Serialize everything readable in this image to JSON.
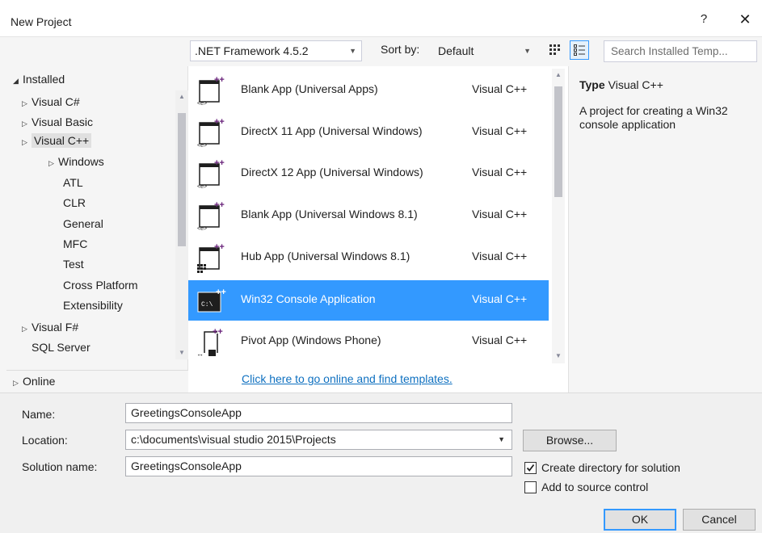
{
  "window": {
    "title": "New Project",
    "help_label": "?",
    "close_label": "✕"
  },
  "toolbar": {
    "framework": ".NET Framework 4.5.2",
    "sort_label": "Sort by:",
    "sort_value": "Default",
    "search_placeholder": "Search Installed Temp..."
  },
  "tree": {
    "installed": "Installed",
    "items": [
      "Visual C#",
      "Visual Basic",
      "Visual C++",
      "Windows",
      "ATL",
      "CLR",
      "General",
      "MFC",
      "Test",
      "Cross Platform",
      "Extensibility",
      "Visual F#",
      "SQL Server"
    ],
    "online": "Online"
  },
  "templates": [
    {
      "name": "Blank App (Universal Apps)",
      "lang": "Visual C++"
    },
    {
      "name": "DirectX 11 App (Universal Windows)",
      "lang": "Visual C++"
    },
    {
      "name": "DirectX 12 App (Universal Windows)",
      "lang": "Visual C++"
    },
    {
      "name": "Blank App (Universal Windows 8.1)",
      "lang": "Visual C++"
    },
    {
      "name": "Hub App (Universal Windows 8.1)",
      "lang": "Visual C++"
    },
    {
      "name": "Win32 Console Application",
      "lang": "Visual C++"
    },
    {
      "name": "Pivot App (Windows Phone)",
      "lang": "Visual C++"
    }
  ],
  "online_link": "Click here to go online and find templates.",
  "details": {
    "type_label": "Type",
    "type_value": "Visual C++",
    "description": "A project for creating a Win32 console application"
  },
  "form": {
    "name_label": "Name:",
    "name_value": "GreetingsConsoleApp",
    "location_label": "Location:",
    "location_value": "c:\\documents\\visual studio 2015\\Projects",
    "solution_label": "Solution name:",
    "solution_value": "GreetingsConsoleApp",
    "browse_label": "Browse...",
    "create_dir_label": "Create directory for solution",
    "create_dir_checked": true,
    "source_control_label": "Add to source control",
    "source_control_checked": false,
    "ok_label": "OK",
    "cancel_label": "Cancel"
  },
  "colors": {
    "accent": "#3399ff",
    "icon_purple": "#68217a",
    "link": "#0e70c0"
  }
}
